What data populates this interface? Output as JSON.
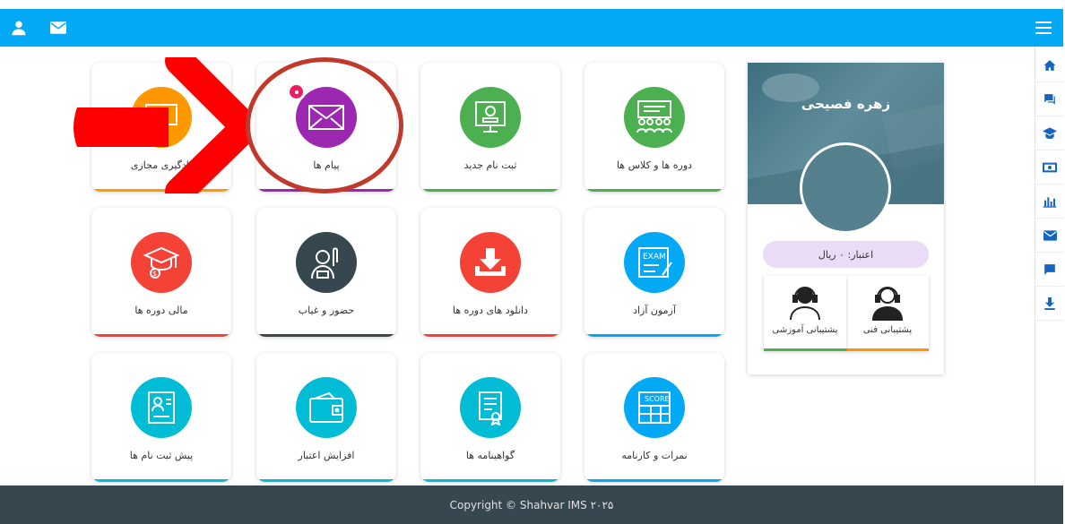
{
  "cards": [
    {
      "id": "courses",
      "label": "دوره ها و کلاس ها",
      "color": "#4caf50",
      "icon": "classroom-icon"
    },
    {
      "id": "register",
      "label": "ثبت نام جدید",
      "color": "#4caf50",
      "icon": "monitor-registration-icon"
    },
    {
      "id": "messages",
      "label": "پیام ها",
      "color": "#9c27b0",
      "icon": "envelope-icon"
    },
    {
      "id": "virtual",
      "label": "یادگیری مجازی",
      "color": "#ff9800",
      "icon": "video-learning-icon"
    },
    {
      "id": "exam",
      "label": "آزمون آزاد",
      "color": "#03a9f4",
      "icon": "exam-icon"
    },
    {
      "id": "downloads",
      "label": "دانلود های دوره ها",
      "color": "#f44336",
      "icon": "download-tray-icon"
    },
    {
      "id": "attendance",
      "label": "حضور و غیاب",
      "color": "#37474f",
      "icon": "raise-hand-icon"
    },
    {
      "id": "finance",
      "label": "مالی دوره ها",
      "color": "#f44336",
      "icon": "graduation-money-icon"
    },
    {
      "id": "grades",
      "label": "نمرات و کارنامه",
      "color": "#03a9f4",
      "icon": "score-sheet-icon"
    },
    {
      "id": "certificates",
      "label": "گواهینامه ها",
      "color": "#00bcd4",
      "icon": "certificate-icon"
    },
    {
      "id": "credit",
      "label": "افزایش اعتبار",
      "color": "#00bcd4",
      "icon": "wallet-icon"
    },
    {
      "id": "preregister",
      "label": "پیش ثبت نام ها",
      "color": "#00bcd4",
      "icon": "pre-registration-icon"
    }
  ],
  "profile": {
    "name": "زهره فصیحی",
    "credit": "اعتبار: ۰ ریال",
    "support_tech": "پشتیبانی فنی",
    "support_edu": "پشتیبانی آموزشی",
    "support_tech_color": "#ff9800",
    "support_edu_color": "#4caf50"
  },
  "footer": {
    "copyright": "Copyright © Shahvar IMS ۲۰۲۵"
  },
  "colors": {
    "header": "#03a9f4",
    "footer": "#37474f",
    "annotation_arrow": "#ff0000",
    "annotation_circle": "#c0392b"
  },
  "topbar_icons": [
    "user-icon",
    "mail-icon",
    "menu-icon"
  ],
  "sidebar_icons": [
    "home-icon",
    "chat-icon",
    "graduation-cap-icon",
    "money-icon",
    "bar-chart-icon",
    "mail-icon",
    "message-icon",
    "download-icon"
  ]
}
